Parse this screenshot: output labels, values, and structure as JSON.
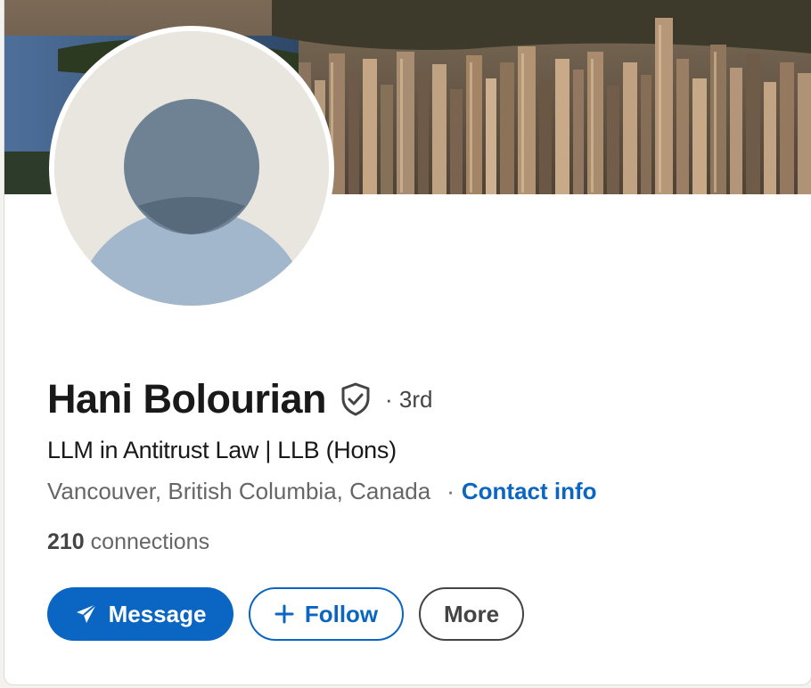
{
  "profile": {
    "name": "Hani Bolourian",
    "degree": "· 3rd",
    "headline": "LLM in Antitrust Law | LLB (Hons)",
    "location": "Vancouver, British Columbia, Canada",
    "separator": "·",
    "contact_label": "Contact info",
    "connections_count": "210",
    "connections_label": " connections"
  },
  "actions": {
    "message": "Message",
    "follow": "Follow",
    "more": "More"
  },
  "icons": {
    "verified": "shield-check-icon",
    "message": "send-icon",
    "follow": "plus-icon"
  },
  "colors": {
    "accent": "#0a66c2",
    "name_text": "#191919",
    "secondary_text": "#666666"
  }
}
